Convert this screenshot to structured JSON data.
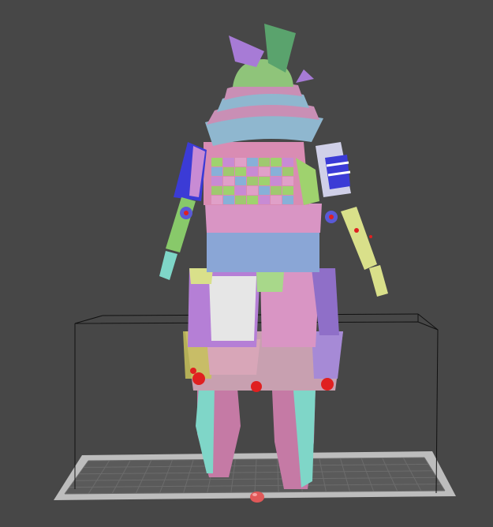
{
  "viewport": {
    "background_color": "#474747",
    "floor_color": "#bdbdbd",
    "grid_color": "#6a6a6a",
    "bbox_color": "#111111"
  },
  "model": {
    "colors": {
      "helmet": "#8fc47a",
      "crest": "#a77bd6",
      "crest2": "#5aa36d",
      "brim": "#c98fb5",
      "brim2": "#8fb7cf",
      "torso": "#d98cb3",
      "checker_a": "#9fd26e",
      "checker_b": "#c88bd4",
      "band_blue": "#8aa6d6",
      "band_pink": "#d995c4",
      "skirt_white": "#e6e6e6",
      "skirt_purple": "#b57fd6",
      "arm_green": "#88c96a",
      "arm_yellow": "#d9e08a",
      "shoulder_blue": "#3b3bd6",
      "leg_pink": "#c57aa5",
      "leg_cyan": "#7fd6c8",
      "red_accent": "#e02020"
    }
  }
}
